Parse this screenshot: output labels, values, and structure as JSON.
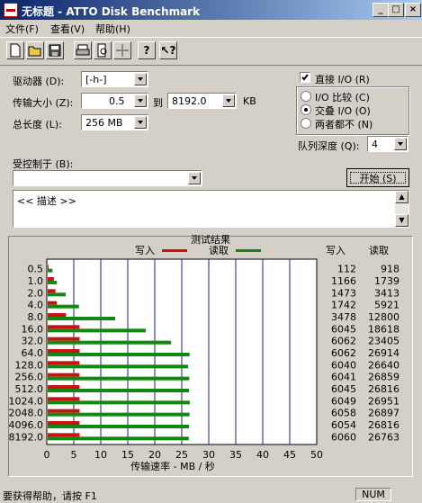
{
  "window": {
    "title": "无标题 - ATTO Disk Benchmark"
  },
  "menu": [
    "文件(F)",
    "查看(V)",
    "帮助(H)"
  ],
  "toolbar": {
    "icons": [
      "new-doc-icon",
      "open-folder-icon",
      "save-icon",
      "print-icon",
      "print-preview-icon",
      "move-icon",
      "help-icon",
      "context-help-icon"
    ]
  },
  "drive": {
    "label": "驱动器 (D):",
    "value": "[-h-]"
  },
  "transfer": {
    "label": "传输大小 (Z):",
    "from": "0.5",
    "to_label": "到",
    "to": "8192.0",
    "unit": "KB"
  },
  "length": {
    "label": "总长度 (L):",
    "value": "256 MB"
  },
  "direct_io": {
    "label": "直接 I/O (R)",
    "checked": true
  },
  "io_options": [
    {
      "label": "I/O 比较 (C)",
      "selected": false
    },
    {
      "label": "交叠 I/O (O)",
      "selected": true
    },
    {
      "label": "两者都不 (N)",
      "selected": false
    }
  ],
  "queue": {
    "label": "队列深度 (Q):",
    "value": "4"
  },
  "controlled": {
    "label": "受控制于 (B):",
    "value": ""
  },
  "start_button": "开始 (S)",
  "description": "<< 描述 >>",
  "results": {
    "title": "测试结果",
    "legend_write": "写入",
    "legend_read": "读取",
    "col_write": "写入",
    "col_read": "读取",
    "colors": {
      "write": "#cc1111",
      "read": "#118811"
    }
  },
  "chart_data": {
    "type": "bar",
    "orientation": "horizontal",
    "categories": [
      "0.5",
      "1.0",
      "2.0",
      "4.0",
      "8.0",
      "16.0",
      "32.0",
      "64.0",
      "128.0",
      "256.0",
      "512.0",
      "1024.0",
      "2048.0",
      "4096.0",
      "8192.0"
    ],
    "series": [
      {
        "name": "写入",
        "values": [
          112,
          1166,
          1473,
          1742,
          3478,
          6045,
          6062,
          6062,
          6040,
          6041,
          6045,
          6049,
          6058,
          6054,
          6060
        ]
      },
      {
        "name": "读取",
        "values": [
          918,
          1739,
          3413,
          5921,
          12800,
          18618,
          23405,
          26914,
          26640,
          26859,
          26816,
          26951,
          26897,
          26816,
          26763
        ]
      }
    ],
    "xticks": [
      "0",
      "5",
      "10",
      "15",
      "20",
      "25",
      "30",
      "35",
      "40",
      "45",
      "50"
    ],
    "xlim": [
      0,
      50
    ],
    "xlabel": "传输速率 - MB / 秒",
    "grid": true
  },
  "status": {
    "text": "要获得帮助，请按 F1",
    "num": "NUM"
  }
}
